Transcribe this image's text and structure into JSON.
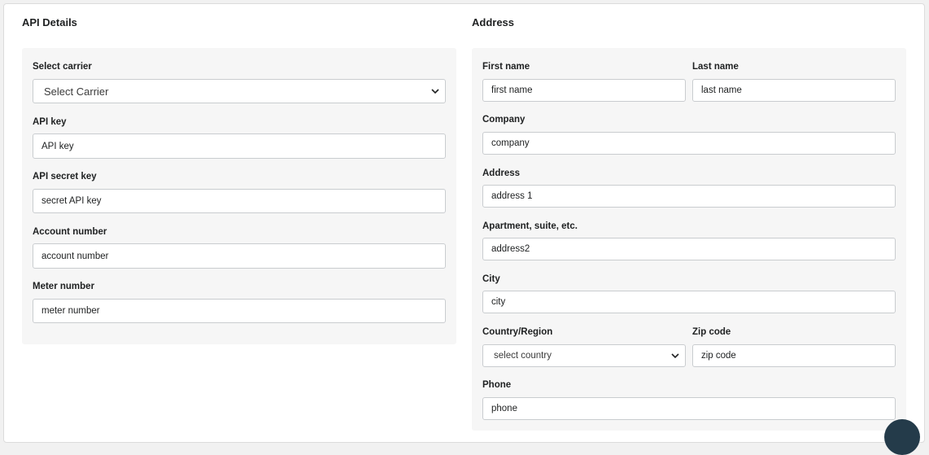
{
  "api_details": {
    "title": "API Details",
    "carrier": {
      "label": "Select carrier",
      "value": "Select Carrier"
    },
    "api_key": {
      "label": "API key",
      "placeholder": "API key"
    },
    "api_secret": {
      "label": "API secret key",
      "placeholder": "secret API key"
    },
    "account_number": {
      "label": "Account number",
      "placeholder": "account number"
    },
    "meter_number": {
      "label": "Meter number",
      "placeholder": "meter number"
    }
  },
  "address": {
    "title": "Address",
    "first_name": {
      "label": "First name",
      "placeholder": "first name"
    },
    "last_name": {
      "label": "Last name",
      "placeholder": "last name"
    },
    "company": {
      "label": "Company",
      "placeholder": "company"
    },
    "address1": {
      "label": "Address",
      "placeholder": "address 1"
    },
    "address2": {
      "label": "Apartment, suite, etc.",
      "placeholder": "address2"
    },
    "city": {
      "label": "City",
      "placeholder": "city"
    },
    "country": {
      "label": "Country/Region",
      "value": "select country"
    },
    "zip": {
      "label": "Zip code",
      "placeholder": "zip code"
    },
    "phone": {
      "label": "Phone",
      "placeholder": "phone"
    }
  },
  "icons": {
    "select_chevron": "chevron-down-icon",
    "chat_button": "chat-bubble-icon"
  },
  "colors": {
    "panel_bg": "#f6f6f6",
    "border": "#c9cccf",
    "fab": "#243b4a"
  }
}
